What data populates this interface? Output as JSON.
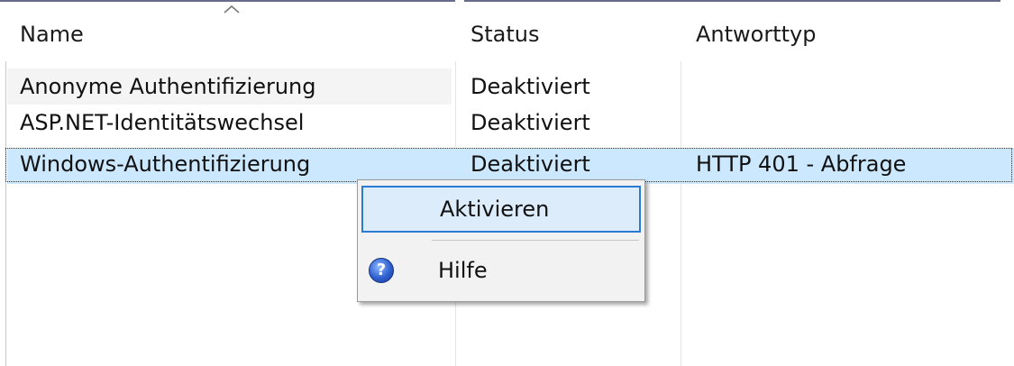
{
  "columns": {
    "name": "Name",
    "status": "Status",
    "response_type": "Antworttyp"
  },
  "rows": [
    {
      "name": "Anonyme Authentifizierung",
      "status": "Deaktiviert",
      "response_type": ""
    },
    {
      "name": "ASP.NET-Identitätswechsel",
      "status": "Deaktiviert",
      "response_type": ""
    },
    {
      "name": "Windows-Authentifizierung",
      "status": "Deaktiviert",
      "response_type": "HTTP 401 - Abfrage"
    }
  ],
  "selected_row_index": 2,
  "context_menu": {
    "items": [
      {
        "label": "Aktivieren",
        "icon": ""
      },
      {
        "label": "Hilfe",
        "icon": "help-icon"
      }
    ]
  },
  "colors": {
    "selection": "#cce8ff",
    "menu_highlight": "#dcecfb",
    "menu_highlight_border": "#2b7bd3",
    "menu_background": "#f2f2f2"
  },
  "icons": {
    "sort": "chevron-up-icon",
    "help": "question-mark-icon"
  }
}
